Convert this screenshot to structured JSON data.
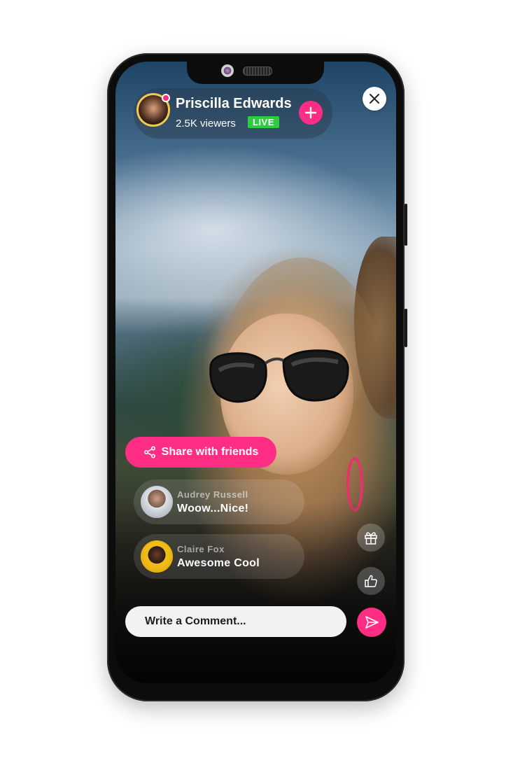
{
  "host": {
    "name": "Priscilla Edwards",
    "viewers": "2.5K viewers",
    "live_label": "LIVE"
  },
  "actions": {
    "share_label": "Share with friends"
  },
  "comments": [
    {
      "author": "Audrey Russell",
      "text": "Woow...Nice!"
    },
    {
      "author": "Claire Fox",
      "text": "Awesome Cool"
    }
  ],
  "composer": {
    "placeholder": "Write a Comment..."
  },
  "icons": {
    "follow": "plus-icon",
    "close": "close-icon",
    "share": "share-icon",
    "gift": "gift-icon",
    "like": "thumbs-up-icon",
    "send": "send-icon"
  },
  "colors": {
    "accent": "#ff2d83",
    "live": "#2ecc40"
  }
}
